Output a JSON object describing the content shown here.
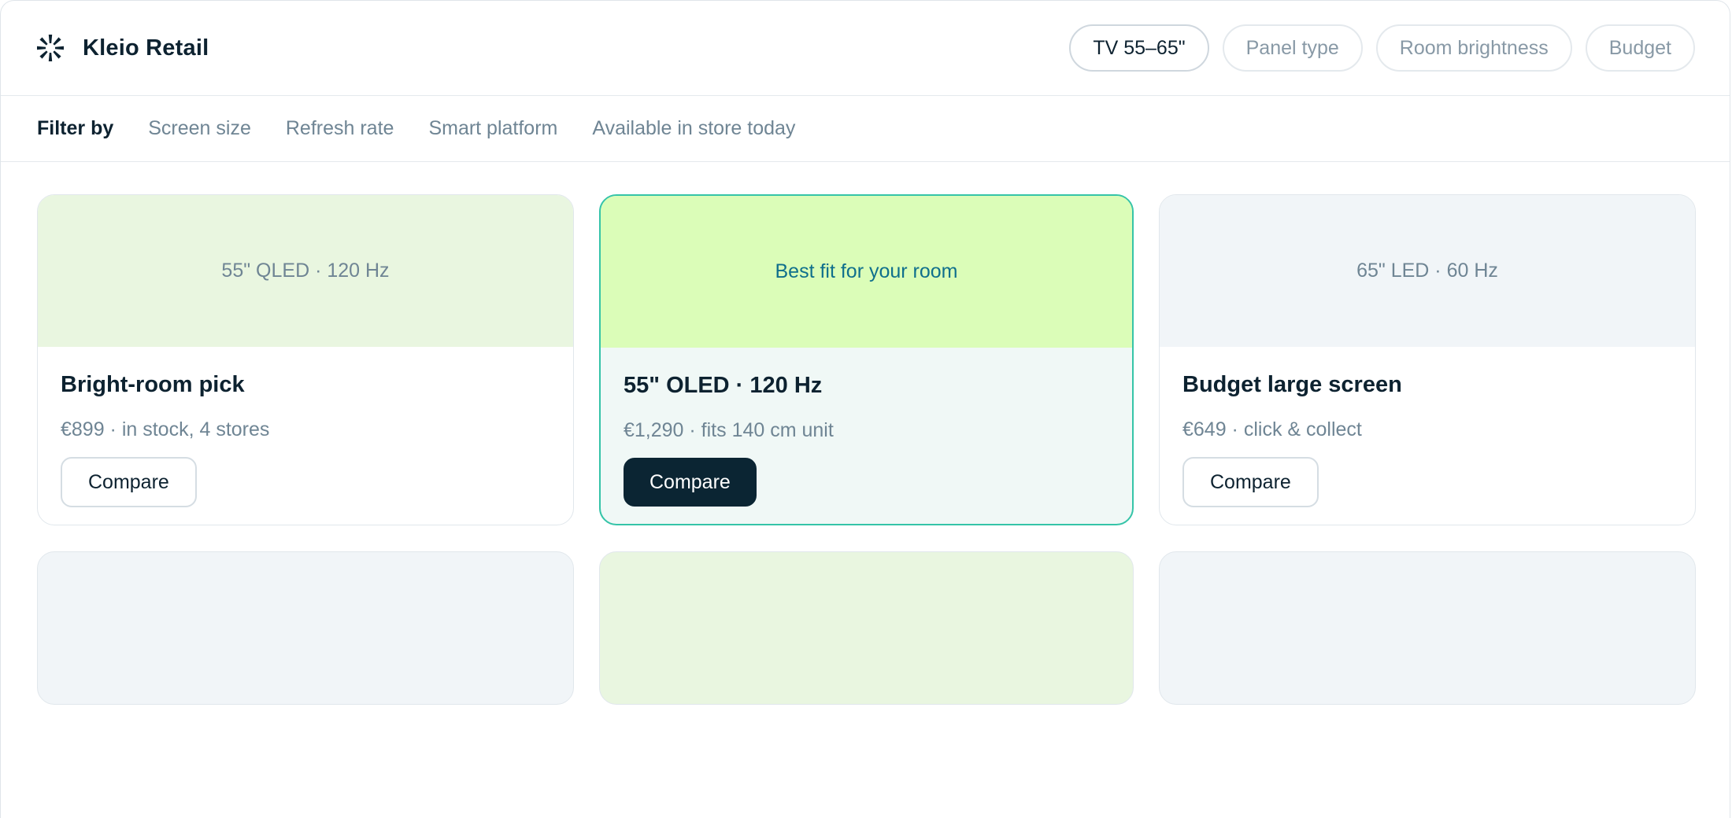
{
  "header": {
    "brand_name": "Kleio Retail",
    "brand_icon": "spark-icon",
    "chips": [
      {
        "label": "TV 55–65\"",
        "active": true
      },
      {
        "label": "Panel type",
        "active": false
      },
      {
        "label": "Room brightness",
        "active": false
      },
      {
        "label": "Budget",
        "active": false
      }
    ]
  },
  "filters": {
    "label": "Filter by",
    "items": [
      "Screen size",
      "Refresh rate",
      "Smart platform",
      "Available in store today"
    ]
  },
  "cards": [
    {
      "thumb_text": "55\" QLED · 120 Hz",
      "title": "Bright-room pick",
      "meta": "€899 · in stock, 4 stores",
      "button": "Compare",
      "featured": false
    },
    {
      "thumb_text": "Best fit for your room",
      "title": "55\" OLED · 120 Hz",
      "meta": "€1,290 · fits 140 cm unit",
      "button": "Compare",
      "featured": true
    },
    {
      "thumb_text": "65\" LED · 60 Hz",
      "title": "Budget large screen",
      "meta": "€649 · click & collect",
      "button": "Compare",
      "featured": false
    }
  ],
  "colors": {
    "accent": "#35c4a8",
    "primary_button": "#0b2533",
    "thumb_green": "#e9f6e0",
    "thumb_lime": "#dbfdb8",
    "thumb_grey": "#f1f5f8"
  }
}
